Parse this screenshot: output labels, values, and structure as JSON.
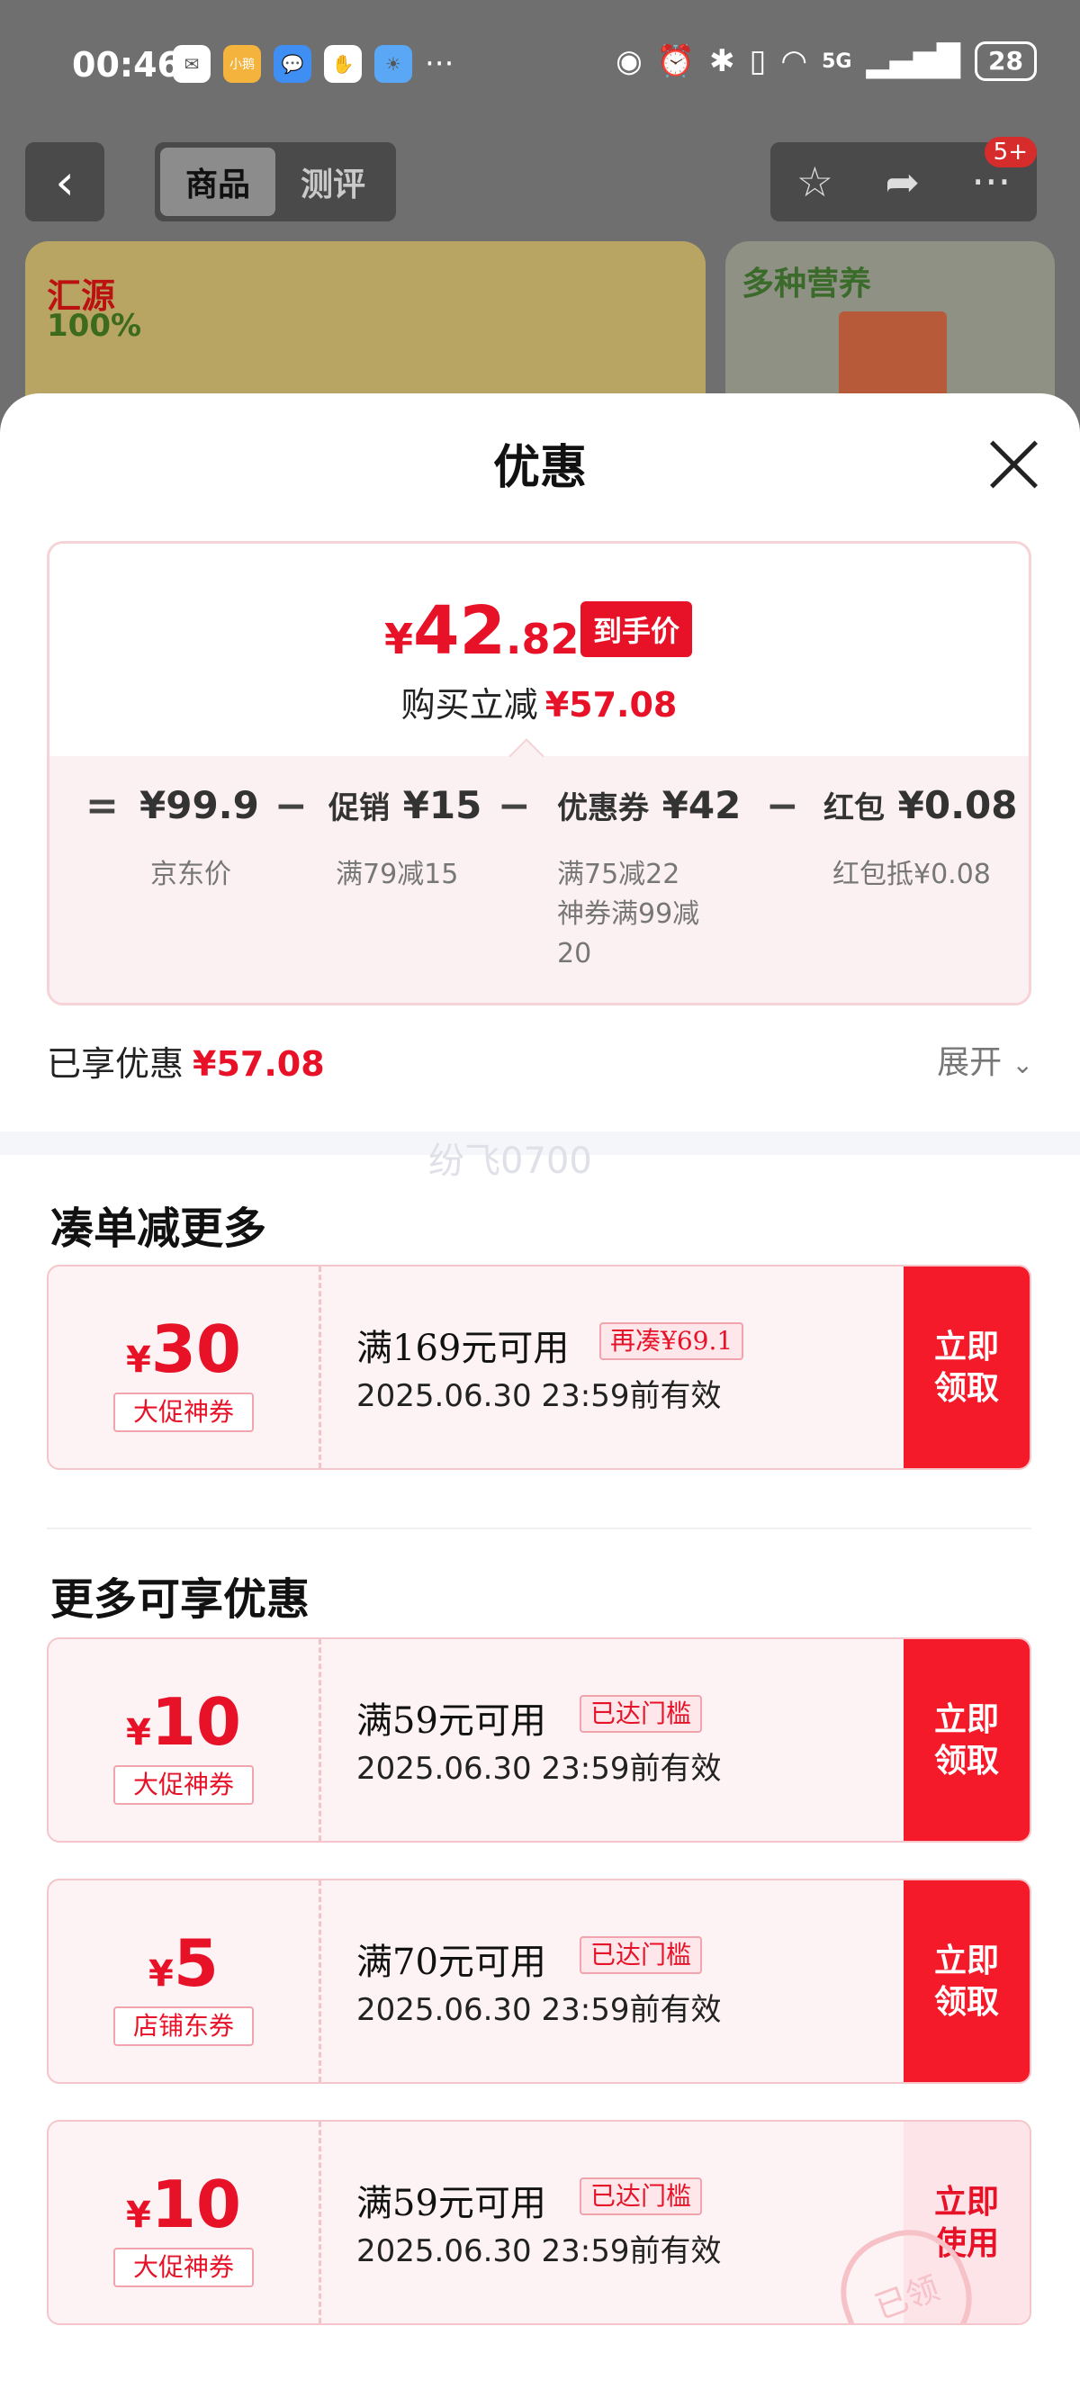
{
  "status": {
    "time": "00:46",
    "apps": [
      "WeChat",
      "小鹅",
      "Messages",
      "Hand",
      "Weather"
    ],
    "more": "···",
    "network": "5G",
    "battery": "28"
  },
  "nav": {
    "back_icon": "chevron-left-icon",
    "tabs": [
      {
        "label": "商品",
        "active": true
      },
      {
        "label": "测评",
        "active": false
      }
    ],
    "badge": "5+"
  },
  "product": {
    "brand": "汇源",
    "brand_sub": "100%",
    "nutrition_title": "多种营养"
  },
  "sheet": {
    "title": "优惠",
    "price": {
      "currency": "¥",
      "integer": "42",
      "decimal": ".82",
      "tag": "到手价",
      "reduce_label": "购买立减",
      "reduce_value": "¥57.08"
    },
    "breakdown": [
      {
        "op": "=",
        "label": "",
        "value": "¥99.9",
        "subs": [
          "京东价"
        ]
      },
      {
        "op": "−",
        "label": "促销",
        "value": "¥15",
        "subs": [
          "满79减15"
        ]
      },
      {
        "op": "−",
        "label": "优惠券",
        "value": "¥42",
        "subs": [
          "满75减22",
          "神券满99减",
          "20"
        ]
      },
      {
        "op": "−",
        "label": "红包",
        "value": "¥0.08",
        "subs": [
          "红包抵¥0.08"
        ]
      }
    ],
    "enjoyed_label": "已享优惠",
    "enjoyed_value": "¥57.08",
    "expand_label": "展开",
    "watermark": "纷飞0700"
  },
  "sections": {
    "more_order": "凑单减更多",
    "more_offers": "更多可享优惠"
  },
  "coupons": [
    {
      "amount": "30",
      "currency": "¥",
      "type": "大促神券",
      "condition": "满169元可用",
      "tag": "再凑¥69.1",
      "valid": "2025.06.30 23:59前有效",
      "button": "立即\n领取",
      "used": false
    },
    {
      "amount": "10",
      "currency": "¥",
      "type": "大促神券",
      "condition": "满59元可用",
      "tag": "已达门槛",
      "valid": "2025.06.30 23:59前有效",
      "button": "立即\n领取",
      "used": false
    },
    {
      "amount": "5",
      "currency": "¥",
      "type": "店铺东券",
      "condition": "满70元可用",
      "tag": "已达门槛",
      "valid": "2025.06.30 23:59前有效",
      "button": "立即\n领取",
      "used": false
    },
    {
      "amount": "10",
      "currency": "¥",
      "type": "大促神券",
      "condition": "满59元可用",
      "tag": "已达门槛",
      "valid": "2025.06.30 23:59前有效",
      "button": "立即\n使用",
      "used": true,
      "stamp": "已领"
    }
  ],
  "colors": {
    "accent": "#e81228",
    "button": "#f51a2a",
    "coupon_bg": "#fdf3f4"
  }
}
